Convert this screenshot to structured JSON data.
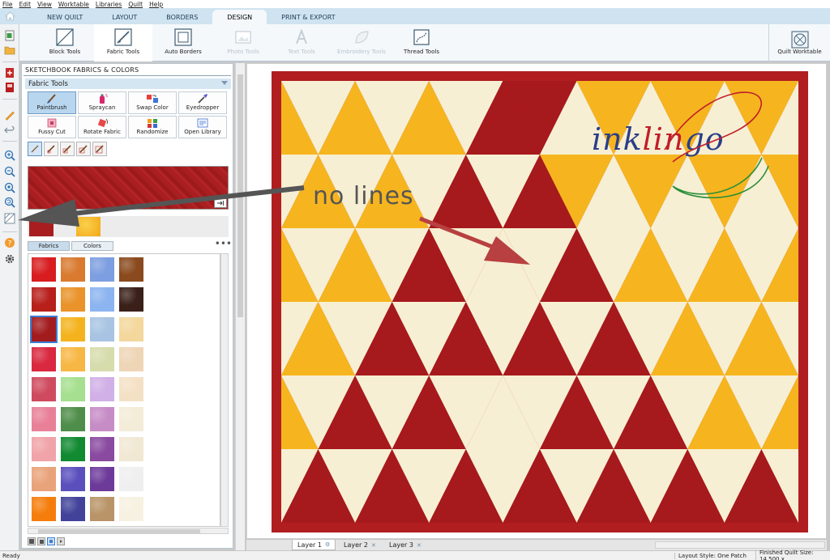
{
  "menu": [
    "File",
    "Edit",
    "View",
    "Worktable",
    "Libraries",
    "Quilt",
    "Help"
  ],
  "tabs": [
    {
      "label": "NEW QUILT",
      "active": false
    },
    {
      "label": "LAYOUT",
      "active": false
    },
    {
      "label": "BORDERS",
      "active": false
    },
    {
      "label": "DESIGN",
      "active": true
    },
    {
      "label": "PRINT & EXPORT",
      "active": false
    }
  ],
  "ribbon": {
    "block_tools": "Block Tools",
    "fabric_tools": "Fabric Tools",
    "auto_borders": "Auto Borders",
    "photo_tools": "Photo Tools",
    "text_tools": "Text Tools",
    "embroidery_tools": "Embroidery Tools",
    "thread_tools": "Thread Tools",
    "quilt_worktable": "Quilt Worktable"
  },
  "palette": {
    "title": "SKETCHBOOK FABRICS & COLORS",
    "section": "Fabric Tools",
    "tools": [
      "Paintbrush",
      "Spraycan",
      "Swap Color",
      "Eyedropper",
      "Fussy Cut",
      "Rotate Fabric",
      "Randomize",
      "Open Library"
    ],
    "active_tool": "Paintbrush",
    "subtabs": {
      "fabrics": "Fabrics",
      "colors": "Colors"
    },
    "more": "•••"
  },
  "colors": {
    "red": "#a6191c",
    "red_dark": "#8f1214",
    "cream": "#f7efd3",
    "yellow": "#f6b51e",
    "yellow_light": "#fbcf47",
    "background_red": "#b01e20"
  },
  "fabrics": [
    [
      "#d81d20",
      "#d97a2f",
      "#7d9ee0",
      "#8a4a1e"
    ],
    [
      "#b8201c",
      "#e9932a",
      "#8cb4f0",
      "#3a2018"
    ],
    [
      "#a21b1d",
      "#f4b31e",
      "#a8c4e2",
      "#f3d79c"
    ],
    [
      "#d9283f",
      "#f7b744",
      "#d7dcad",
      "#eed5b6"
    ],
    [
      "#cf4a5e",
      "#a6df8f",
      "#d0b0e6",
      "#f4e1c5"
    ],
    [
      "#e88098",
      "#4f8d4a",
      "#c68cc6",
      "#f3ecd8"
    ],
    [
      "#f0a3a8",
      "#128a32",
      "#8a4aa0",
      "#f1e8d4"
    ],
    [
      "#e9a37a",
      "#5a4fbd",
      "#6d3a9a",
      "#efefef"
    ],
    [
      "#f57d0c",
      "#42429a",
      "#b99468",
      "#f6f1e1"
    ]
  ],
  "annotation": "no lines",
  "logo": {
    "part1": "ink",
    "part2": "lin",
    "part3": "go"
  },
  "layers": [
    {
      "label": "Layer 1",
      "active": true
    },
    {
      "label": "Layer 2",
      "active": false
    },
    {
      "label": "Layer 3",
      "active": false
    }
  ],
  "status": {
    "ready": "Ready",
    "layout_style": "Layout Style: One Patch",
    "finished_size": "Finished Quilt Size: 14.500 x"
  }
}
